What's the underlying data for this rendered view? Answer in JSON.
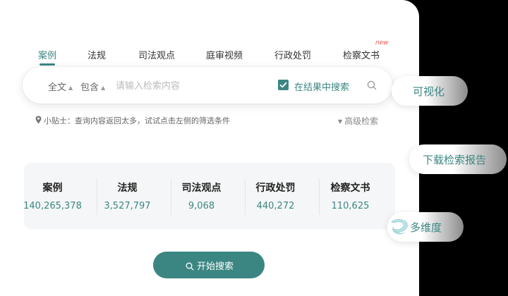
{
  "tabs": [
    {
      "label": "案例",
      "active": true
    },
    {
      "label": "法规"
    },
    {
      "label": "司法观点"
    },
    {
      "label": "庭审视频"
    },
    {
      "label": "行政处罚"
    },
    {
      "label": "检察文书",
      "badge": "new"
    }
  ],
  "search": {
    "scope_select": "全文",
    "match_select": "包含",
    "placeholder": "请输入检索内容",
    "value": "",
    "in_results_checked": true,
    "in_results_label": "在结果中搜索"
  },
  "tip": "小贴士：查询内容返回太多，试试点击左侧的筛选条件",
  "advanced_search": "高级检索",
  "stats": [
    {
      "label": "案例",
      "value": "140,265,378"
    },
    {
      "label": "法规",
      "value": "3,527,797"
    },
    {
      "label": "司法观点",
      "value": "9,068"
    },
    {
      "label": "行政处罚",
      "value": "440,272"
    },
    {
      "label": "检察文书",
      "value": "110,625"
    }
  ],
  "start_search_label": "开始搜索",
  "side_buttons": {
    "visualize": "可视化",
    "download_report": "下载检索报告",
    "multi_dimension": "多维度"
  },
  "colors": {
    "accent": "#3b8683",
    "badge": "#e55a4e"
  }
}
